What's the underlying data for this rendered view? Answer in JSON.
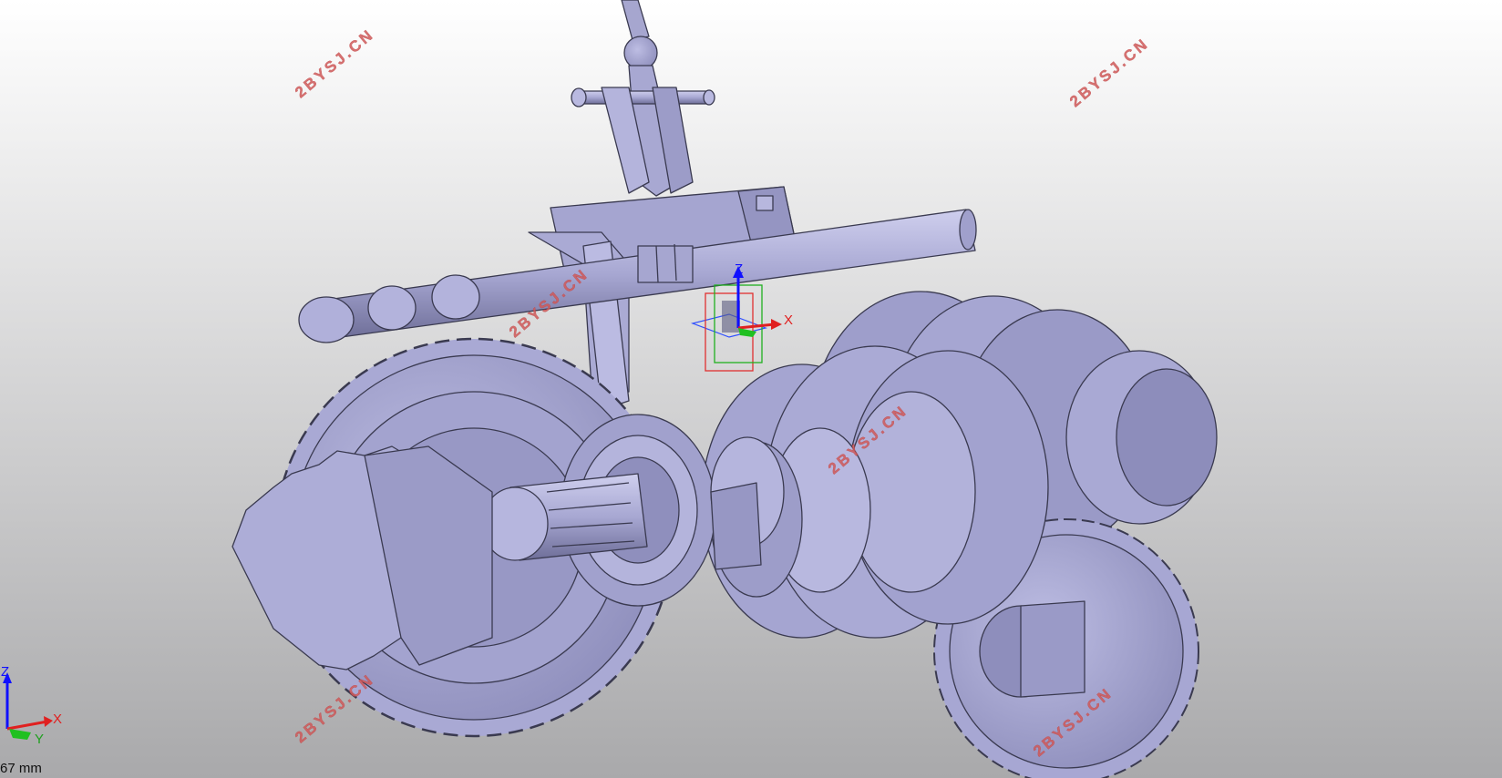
{
  "viewport": {
    "background_top": "#ffffff",
    "background_bottom": "#a9a9ab",
    "part_color": "#aeaed8",
    "edge_color": "#3a3a50"
  },
  "watermarks": [
    "2BYSJ.CN",
    "2BYSJ.CN",
    "2BYSJ.CN",
    "2BYSJ.CN",
    "2BYSJ.CN",
    "2BYSJ.CN"
  ],
  "triad": {
    "x_label": "X",
    "y_label": "Y",
    "z_label": "Z"
  },
  "manipulator": {
    "x_label": "X",
    "z_label": "Z"
  },
  "scale": {
    "text": "67 mm"
  },
  "icons": {
    "global_triad": "xyz-triad-icon",
    "manipulator": "move-manipulator-icon"
  }
}
